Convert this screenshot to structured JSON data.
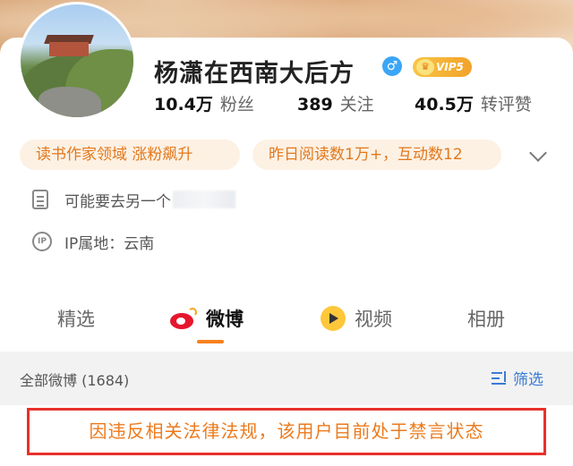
{
  "profile": {
    "name": "杨潇在西南大后方",
    "gender_icon": "male-icon",
    "gender_symbol": "♂",
    "vip_label": "VIP5",
    "crown_symbol": "♛"
  },
  "stats": [
    {
      "value": "10.4万",
      "label": "粉丝"
    },
    {
      "value": "389",
      "label": "关注"
    },
    {
      "value": "40.5万",
      "label": "转评赞"
    }
  ],
  "tags": [
    {
      "text": "读书作家领域 涨粉飙升"
    },
    {
      "text": "昨日阅读数1万+，互动数12"
    }
  ],
  "info": {
    "bio": "可能要去另一个",
    "ip_icon_text": "IP",
    "ip_location": "IP属地：云南"
  },
  "tabs": [
    {
      "label": "精选"
    },
    {
      "label": "微博"
    },
    {
      "label": "视频"
    },
    {
      "label": "相册"
    }
  ],
  "active_tab": "微博",
  "filter": {
    "count_text": "全部微博 (1684)",
    "button_label": "筛选"
  },
  "notice": {
    "text": "因违反相关法律法规，该用户目前处于禁言状态"
  },
  "colors": {
    "accent_orange": "#f6811e",
    "tag_text": "#e2781b",
    "link_blue": "#3a7bd5",
    "ban_border": "#e8312a"
  }
}
